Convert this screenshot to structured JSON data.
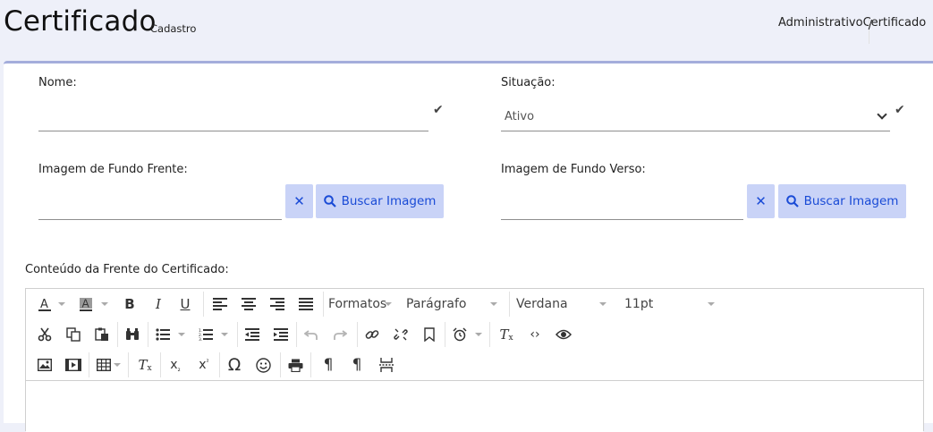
{
  "header": {
    "title": "Certificado",
    "subtitle": "Cadastro",
    "breadcrumb": [
      "Administrativo",
      "/",
      "Certificado"
    ]
  },
  "form": {
    "nome_label": "Nome:",
    "nome_value": "",
    "situacao_label": "Situação:",
    "situacao_value": "Ativo",
    "img_frente_label": "Imagem de Fundo Frente:",
    "img_verso_label": "Imagem de Fundo Verso:",
    "buscar_label": "Buscar Imagem",
    "conteudo_label": "Conteúdo da Frente do Certificado:"
  },
  "editor": {
    "formats_label": "Formatos",
    "paragraph_label": "Parágrafo",
    "font_label": "Verdana",
    "size_label": "11pt"
  },
  "colors": {
    "accent": "#1a4bd6",
    "button_bg": "#c9d3f7",
    "header_bg": "#eef0f9",
    "card_border": "#a4addb"
  }
}
